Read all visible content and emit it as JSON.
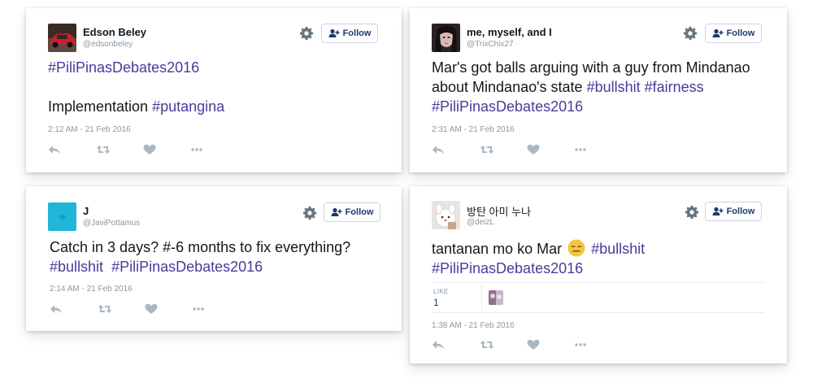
{
  "follow_label": "Follow",
  "colors": {
    "hashtag": "#4b3a9b",
    "meta": "#8899a6",
    "follow_text": "#1b3a72"
  },
  "tweets": [
    {
      "name": "Edson Beley",
      "handle": "@edsonbeley",
      "text_plain_1": "",
      "hashtag_1": "#PiliPinasDebates2016",
      "text_plain_2": "Implementation ",
      "hashtag_2": "#putangina",
      "time": "2:12 AM - 21 Feb 2016"
    },
    {
      "name": "me, myself, and I",
      "handle": "@TrixChix27",
      "text_plain_1": "Mar's got balls arguing with a guy from Mindanao about Mindanao's state ",
      "hashtag_1": "#bullshit",
      "hashtag_2": "#fairness",
      "hashtag_3": "#PiliPinasDebates2016",
      "time": "2:31 AM - 21 Feb 2016"
    },
    {
      "name": "J",
      "handle": "@JaviPottamus",
      "text_plain_1": "Catch in 3 days? #-6 months to fix everything? ",
      "hashtag_1": "#bullshit",
      "hashtag_2": "#PiliPinasDebates2016",
      "time": "2:14 AM - 21 Feb 2016"
    },
    {
      "name": "방탄 아미 누나",
      "handle": "@deizL",
      "text_plain_1": "tantanan mo ko Mar ",
      "emoji": "expressionless-face-emoji",
      "hashtag_1": "#bullshit",
      "hashtag_2": "#PiliPinasDebates2016",
      "likes_label": "LIKE",
      "likes_count": "1",
      "time": "1:38 AM - 21 Feb 2016"
    }
  ],
  "icons": [
    "reply-icon",
    "retweet-icon",
    "heart-icon",
    "more-icon",
    "gear-icon",
    "follow-person-icon"
  ]
}
